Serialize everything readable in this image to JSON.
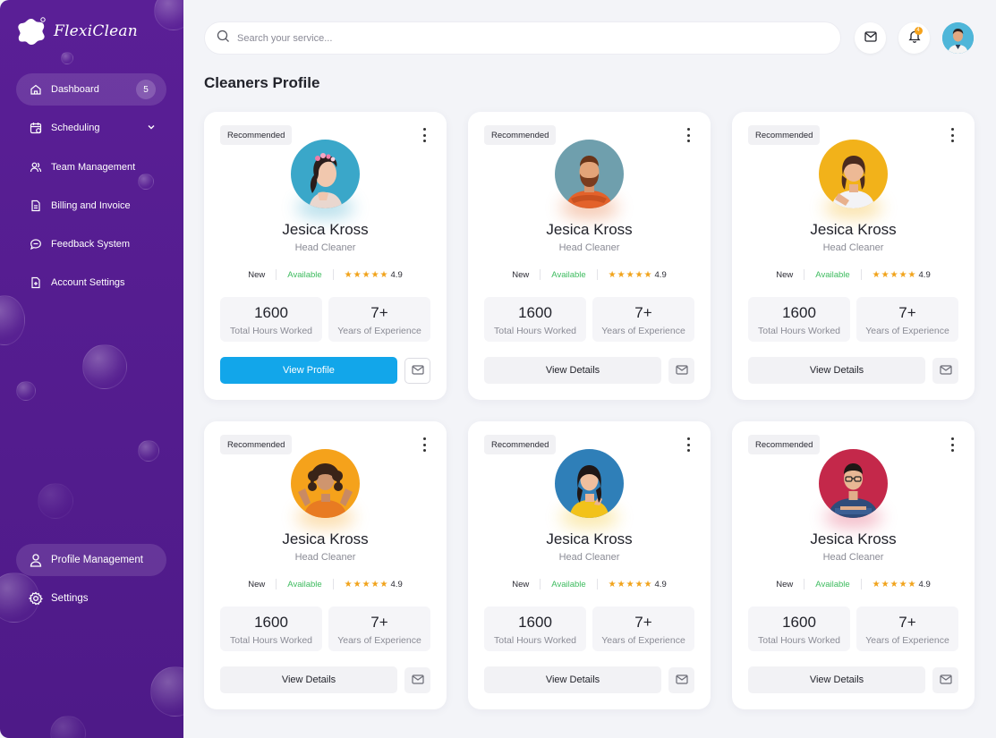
{
  "app": {
    "name": "FlexiClean"
  },
  "sidebar": {
    "items": [
      {
        "label": "Dashboard",
        "badge": "5",
        "icon": "home-icon",
        "active": true
      },
      {
        "label": "Scheduling",
        "icon": "calendar-icon",
        "has_chevron": true
      },
      {
        "label": "Team Management",
        "icon": "users-icon"
      },
      {
        "label": "Billing and Invoice",
        "icon": "document-icon"
      },
      {
        "label": "Feedback System",
        "icon": "chat-icon"
      },
      {
        "label": "Account Settings",
        "icon": "file-plus-icon"
      }
    ],
    "bottom_items": [
      {
        "label": "Profile Management",
        "icon": "user-icon",
        "active": true
      },
      {
        "label": "Settings",
        "icon": "gear-icon"
      }
    ]
  },
  "header": {
    "search_placeholder": "Search your service...",
    "notification_badge": "4"
  },
  "page": {
    "title": "Cleaners Profile"
  },
  "cards": [
    {
      "tag": "Recommended",
      "name": "Jesica Kross",
      "role": "Head Cleaner",
      "status_new": "New",
      "status_available": "Available",
      "rating": "4.9",
      "stars": 5,
      "hours": "1600",
      "hours_label": "Total Hours Worked",
      "experience": "7+",
      "experience_label": "Years of Experience",
      "button": "View Profile",
      "photo_bg": "#3aa7c9",
      "accent": "#3aa7c9"
    },
    {
      "tag": "Recommended",
      "name": "Jesica Kross",
      "role": "Head Cleaner",
      "status_new": "New",
      "status_available": "Available",
      "rating": "4.9",
      "stars": 5,
      "hours": "1600",
      "hours_label": "Total Hours Worked",
      "experience": "7+",
      "experience_label": "Years of Experience",
      "button": "View Details",
      "photo_bg": "#6f9fad",
      "accent": "#e46a2b"
    },
    {
      "tag": "Recommended",
      "name": "Jesica Kross",
      "role": "Head Cleaner",
      "status_new": "New",
      "status_available": "Available",
      "rating": "4.9",
      "stars": 5,
      "hours": "1600",
      "hours_label": "Total Hours Worked",
      "experience": "7+",
      "experience_label": "Years of Experience",
      "button": "View Details",
      "photo_bg": "#f2b21a",
      "accent": "#f2b21a"
    },
    {
      "tag": "Recommended",
      "name": "Jesica Kross",
      "role": "Head Cleaner",
      "status_new": "New",
      "status_available": "Available",
      "rating": "4.9",
      "stars": 5,
      "hours": "1600",
      "hours_label": "Total Hours Worked",
      "experience": "7+",
      "experience_label": "Years of Experience",
      "button": "View Details",
      "photo_bg": "#f5a21b",
      "accent": "#f5a21b"
    },
    {
      "tag": "Recommended",
      "name": "Jesica Kross",
      "role": "Head Cleaner",
      "status_new": "New",
      "status_available": "Available",
      "rating": "4.9",
      "stars": 5,
      "hours": "1600",
      "hours_label": "Total Hours Worked",
      "experience": "7+",
      "experience_label": "Years of Experience",
      "button": "View Details",
      "photo_bg": "#2f7fb8",
      "accent": "#f2c21a"
    },
    {
      "tag": "Recommended",
      "name": "Jesica Kross",
      "role": "Head Cleaner",
      "status_new": "New",
      "status_available": "Available",
      "rating": "4.9",
      "stars": 5,
      "hours": "1600",
      "hours_label": "Total Hours Worked",
      "experience": "7+",
      "experience_label": "Years of Experience",
      "button": "View Details",
      "photo_bg": "#c4284a",
      "accent": "#e0486a"
    }
  ],
  "colors": {
    "sidebar": "#5a1f96",
    "primary_button": "#12a6ea",
    "available": "#3dbb5e",
    "star": "#f1a31b"
  }
}
